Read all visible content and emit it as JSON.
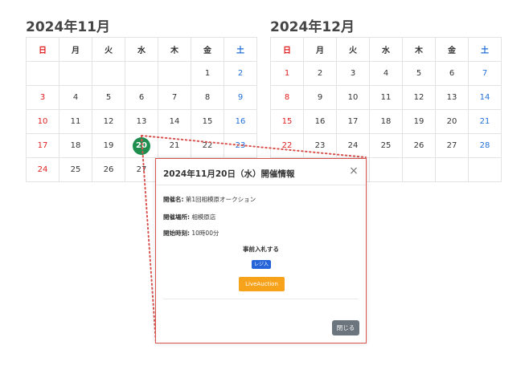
{
  "colors": {
    "sunday": "#e02020",
    "saturday": "#2170d8",
    "today_marker": "#1e8e4e",
    "register_button": "#2563d8",
    "live_button": "#f7a21b",
    "close_button": "#6c757d",
    "highlight_outline": "#d9534f"
  },
  "calendars": [
    {
      "title": "2024年11月",
      "weekdays": [
        "日",
        "月",
        "火",
        "水",
        "木",
        "金",
        "土"
      ],
      "weeks": [
        [
          "",
          "",
          "",
          "",
          "",
          "1",
          "2"
        ],
        [
          "3",
          "4",
          "5",
          "6",
          "7",
          "8",
          "9"
        ],
        [
          "10",
          "11",
          "12",
          "13",
          "14",
          "15",
          "16"
        ],
        [
          "17",
          "18",
          "19",
          "20",
          "21",
          "22",
          "23"
        ],
        [
          "24",
          "25",
          "26",
          "27",
          "",
          "",
          ""
        ]
      ],
      "selected_day": "20"
    },
    {
      "title": "2024年12月",
      "weekdays": [
        "日",
        "月",
        "火",
        "水",
        "木",
        "金",
        "土"
      ],
      "weeks": [
        [
          "1",
          "2",
          "3",
          "4",
          "5",
          "6",
          "7"
        ],
        [
          "8",
          "9",
          "10",
          "11",
          "12",
          "13",
          "14"
        ],
        [
          "15",
          "16",
          "17",
          "18",
          "19",
          "20",
          "21"
        ],
        [
          "22",
          "23",
          "24",
          "25",
          "26",
          "27",
          "28"
        ],
        [
          "",
          "",
          "",
          "",
          "",
          "",
          ""
        ]
      ],
      "selected_day": ""
    }
  ],
  "modal": {
    "title": "2024年11月20日（水）開催情報",
    "close_icon": "×",
    "name_label": "開催名:",
    "name_value": "第1回相模原オークション",
    "place_label": "開催場所:",
    "place_value": "相模原店",
    "time_label": "開始時刻:",
    "time_value": "10時00分",
    "prebid_label": "事前入札する",
    "register_button": "レジ入",
    "live_button": "LiveAuction",
    "close_button": "閉じる"
  }
}
